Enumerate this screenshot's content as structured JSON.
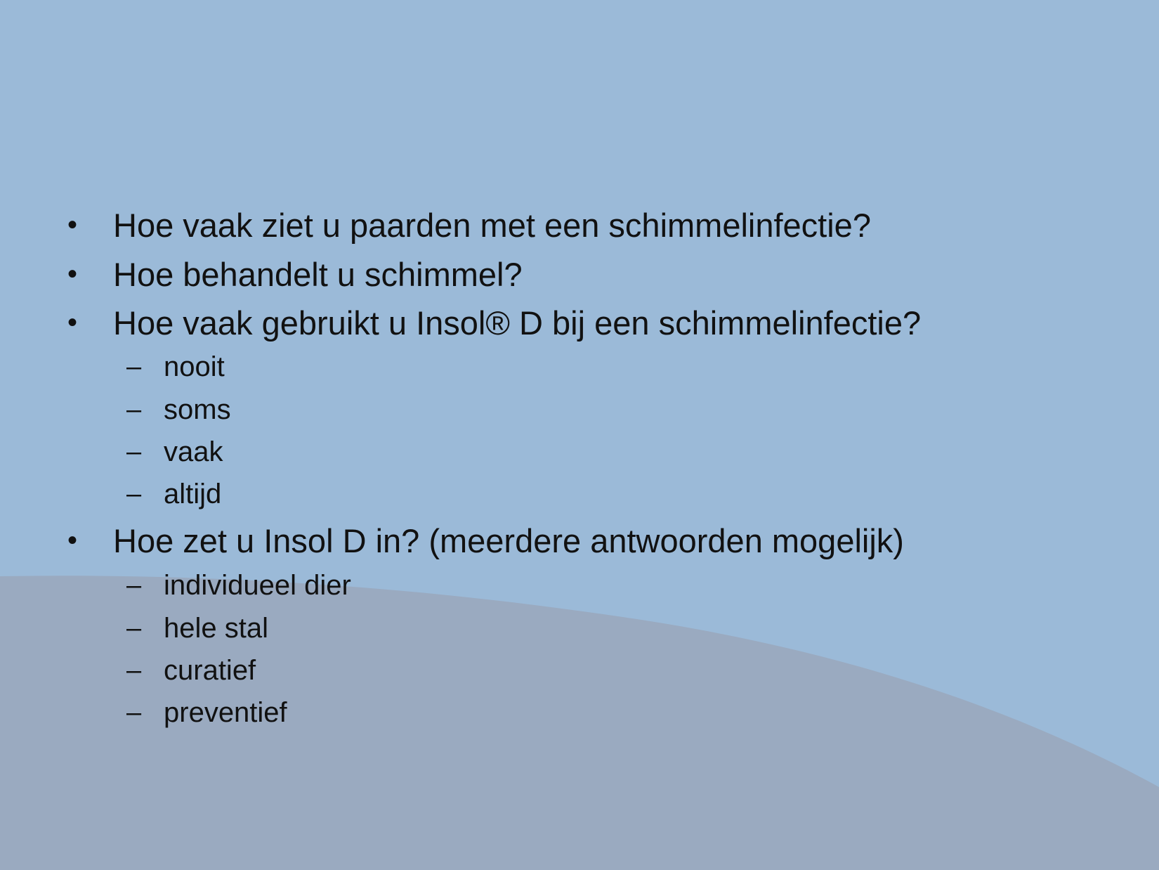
{
  "colors": {
    "background_top": "#9bbad8",
    "background_wave": "#9aaac0",
    "text": "#111111"
  },
  "bullet_symbol": "•",
  "dash_symbol": "–",
  "items": [
    {
      "text": "Hoe vaak ziet u paarden met een schimmelinfectie?"
    },
    {
      "text": "Hoe behandelt u schimmel?"
    },
    {
      "text": "Hoe vaak gebruikt u Insol® D bij een schimmelinfectie?"
    },
    {
      "sub": "nooit"
    },
    {
      "sub": "soms"
    },
    {
      "sub": "vaak"
    },
    {
      "sub": "altijd"
    },
    {
      "text": "Hoe zet u Insol D in? (meerdere antwoorden mogelijk)"
    },
    {
      "sub": "individueel dier"
    },
    {
      "sub": "hele stal"
    },
    {
      "sub": "curatief"
    },
    {
      "sub": "preventief"
    }
  ]
}
